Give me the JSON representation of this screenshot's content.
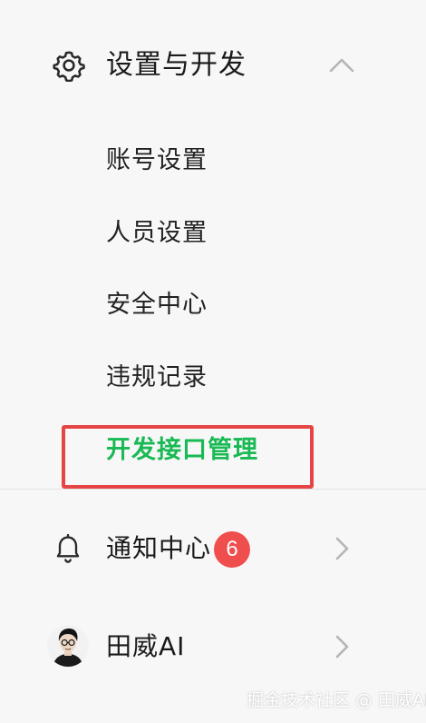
{
  "settings_section": {
    "title": "设置与开发",
    "icon": "gear-icon",
    "expand_icon": "chevron-up-icon",
    "items": [
      {
        "label": "账号设置"
      },
      {
        "label": "人员设置"
      },
      {
        "label": "安全中心"
      },
      {
        "label": "违规记录"
      },
      {
        "label": "开发接口管理",
        "active": true
      }
    ]
  },
  "notifications": {
    "label": "通知中心",
    "icon": "bell-icon",
    "badge_count": "6"
  },
  "profile": {
    "name": "田威AI",
    "icon": "avatar"
  },
  "watermark": "掘金技术社区 @ 田威AI",
  "colors": {
    "background": "#f7f7f7",
    "active": "#19b954",
    "badge": "#f04d4d",
    "highlight_border": "#e64545"
  }
}
